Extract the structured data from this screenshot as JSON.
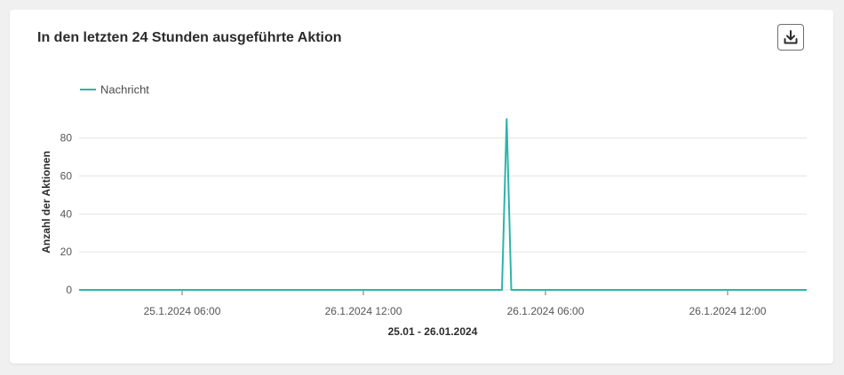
{
  "card": {
    "title": "In den letzten 24 Stunden ausgeführte Aktion",
    "download_icon": "download-icon"
  },
  "colors": {
    "series": "#2cb5a8",
    "grid": "#e4e4e4",
    "axis_text": "#555555"
  },
  "chart_data": {
    "type": "line",
    "title": "In den letzten 24 Stunden ausgeführte Aktion",
    "xlabel": "25.01 - 26.01.2024",
    "ylabel": "Anzahl der Aktionen",
    "x_range": [
      "2024-01-25T00:20",
      "2024-01-26T15:20"
    ],
    "x_ticks": [
      {
        "t": "2024-01-25T06:00",
        "label": "25.1.2024 06:00"
      },
      {
        "t": "2024-01-26T12:00",
        "label": "26.1.2024 12:00"
      },
      {
        "t": "2024-01-26T06:00",
        "label": "26.1.2024 06:00"
      },
      {
        "t": "2024-01-26T12:00",
        "label": "26.1.2024 12:00"
      }
    ],
    "y_ticks": [
      0,
      20,
      40,
      60,
      80
    ],
    "ylim": [
      0,
      92
    ],
    "grid": true,
    "legend_position": "top-left",
    "series": [
      {
        "name": "Nachricht",
        "points": [
          {
            "x": "2024-01-25T00:20",
            "y": 0
          },
          {
            "x": "2024-01-25T23:00",
            "y": 0
          },
          {
            "x": "2024-01-25T23:15",
            "y": 90
          },
          {
            "x": "2024-01-25T23:30",
            "y": 0
          },
          {
            "x": "2024-01-26T15:20",
            "y": 0
          }
        ]
      }
    ]
  }
}
